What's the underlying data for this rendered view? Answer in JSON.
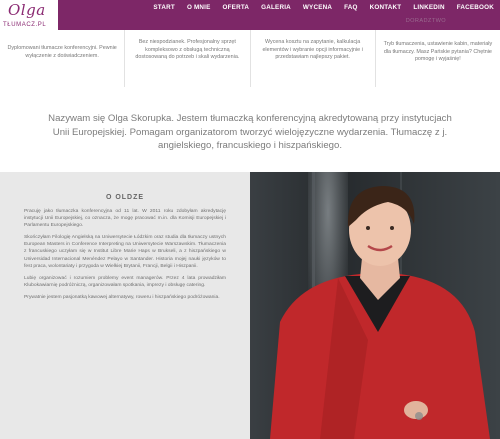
{
  "header": {
    "logo_script": "Olga",
    "logo_sub": "TŁUMACZ.PL",
    "nav": [
      "START",
      "O MNIE",
      "OFERTA",
      "GALERIA",
      "WYCENA",
      "FAQ",
      "KONTAKT",
      "LINKEDIN",
      "FACEBOOK"
    ]
  },
  "features": [
    {
      "text": "Dyplomowani tłumacze konferencyjni. Pewnie wyłączenie z doświadczeniem."
    },
    {
      "text": "Bez niespodzianek. Profesjonalny sprzęt kompleksowo z obsługą techniczną dostosowaną do potrzeb i skali wydarzenia."
    },
    {
      "text": "Wycena kosztu na zapytanie, kalkulacja elementów i wybranie opcji informacyjnie i przedstawiam najlepszy pakiet."
    },
    {
      "heading": "DORADZTWO",
      "text": "Tryb tłumaczenia, ustawienie kabin, materiały dla tłumaczy. Masz Pańskie pytania? Chętnie pomogę i wyjaśnię!"
    }
  ],
  "intro": "Nazywam się Olga Skorupka. Jestem tłumaczką konferencyjną akredytowaną przy instytucjach Unii Europejskiej. Pomagam organizatorom tworzyć wielojęzyczne wydarzenia. Tłumaczę z j. angielskiego, francuskiego i hiszpańskiego.",
  "about": {
    "title": "O OLDZE",
    "paragraphs": [
      "Pracuję jako tłumaczka konferencyjna od 11 lat. W 2011 roku zdobyłam akredytację instytucji Unii Europejskiej, co oznacza, że mogę pracować m.in. dla Komisji Europejskiej i Parlamentu Europejskiego.",
      "Skończyłam Filologię Angielską na Uniwersytecie Łódzkim oraz studia dla tłumaczy ustnych European Masters in Conference Interpreting na Uniwersytecie Warszawskim. Tłumaczenia z francuskiego uczyłam się w Institut Libre Marie Haps w Brukseli, a z hiszpańskiego w Universidad Internacional Menéndez Pelayo w Santander. Historia mojej nauki języków to fest praca, wolontariaty i przygoda w Wielkiej Brytanii, Francji, Belgii i Hiszpanii.",
      "Lubię organizować i rozumiem problemy event managerów. Przez 4 lata prowadziłam Klubokawiarnię podróżniczą, organizowałam spotkania, imprezy i obsługę catering.",
      "Prywatnie jestem pasjonatką kawowej alternatywy, roweru i hiszpańskiego podróżowania."
    ]
  },
  "photo": {
    "alt": "Olga Skorupka"
  },
  "colors": {
    "brand": "#7d2767",
    "about_bg": "#e8e8e8",
    "jacket": "#c0282b"
  }
}
